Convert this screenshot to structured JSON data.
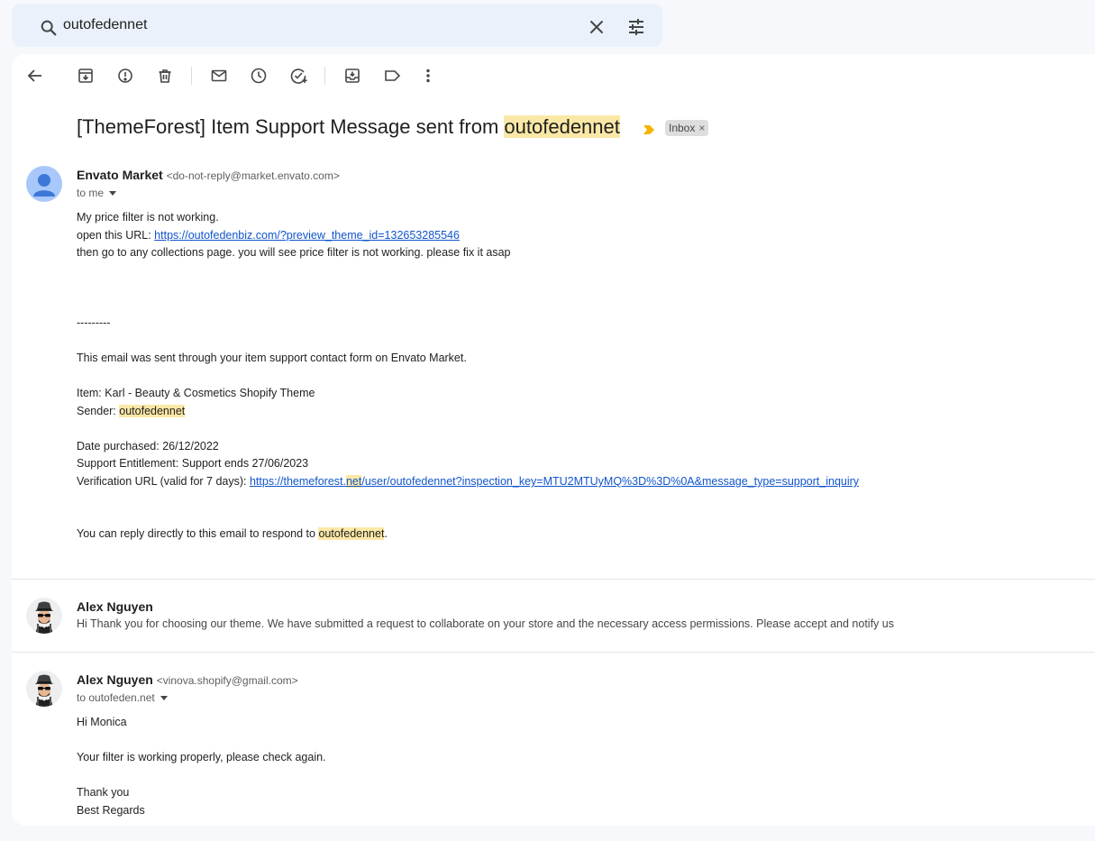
{
  "search": {
    "query": "outofedennet",
    "icon": "search-icon",
    "clear_icon": "close-icon",
    "options_icon": "tune-icon"
  },
  "toolbar": {
    "icons": [
      "back-arrow-icon",
      "archive-icon",
      "report-spam-icon",
      "delete-icon",
      "mark-unread-icon",
      "snooze-icon",
      "add-task-icon",
      "move-to-icon",
      "label-icon",
      "more-vert-icon"
    ]
  },
  "subject": {
    "prefix": "[ThemeForest] Item Support Message sent from ",
    "highlight": "outofedennet",
    "label": "Inbox",
    "label_remove": "×",
    "highlight_color": "#fce8a6",
    "importance_color": "#f4b400"
  },
  "messages": [
    {
      "sender_name": "Envato Market",
      "sender_email": "<do-not-reply@market.envato.com>",
      "to": "to me",
      "body": {
        "line1": "My price filter is not working.",
        "line2_prefix": "open this URL: ",
        "line2_link": "https://outofedenbiz.com/?preview_theme_id=132653285546",
        "line3": "then go to any collections page. you will see price filter is not working. please fix it asap",
        "separator": "---------",
        "notice": "This email was sent through your item support contact form on Envato Market.",
        "item": "Item: Karl - Beauty & Cosmetics Shopify Theme",
        "sender_prefix": "Sender: ",
        "sender_highlight": "outofedennet",
        "date_purchased": "Date purchased: 26/12/2022",
        "entitlement": "Support Entitlement: Support ends 27/06/2023",
        "verification_prefix": "Verification URL (valid for 7 days): ",
        "verification_link_a": "https://themeforest.",
        "verification_link_hl": "net",
        "verification_link_b": "/user/outofedennet?inspection_key=MTU2MTUyMQ%3D%3D%0A&message_type=support_inquiry",
        "reply_prefix": "You can reply directly to this email to respond to ",
        "reply_highlight": "outofedennet",
        "reply_suffix": "."
      }
    },
    {
      "sender_name": "Alex Nguyen",
      "snippet": "Hi Thank you for choosing our theme. We have submitted a request to collaborate on your store and the necessary access permissions. Please accept and notify us"
    },
    {
      "sender_name": "Alex Nguyen",
      "sender_email": "<vinova.shopify@gmail.com>",
      "to": "to outofeden.net",
      "body": {
        "greeting": "Hi Monica",
        "text": "Your filter is working properly, please check again.",
        "thanks": "Thank you",
        "regards": "Best Regards"
      }
    }
  ]
}
